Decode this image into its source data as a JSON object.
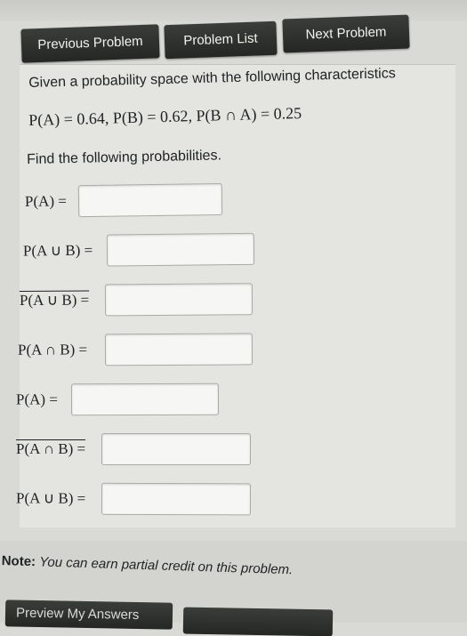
{
  "nav": {
    "previous_label": "Previous Problem",
    "list_label": "Problem List",
    "next_label": "Next Problem"
  },
  "problem": {
    "intro": "Given a probability space with the following characteristics",
    "given": "P(A) = 0.64, P(B) = 0.62, P(B ∩ A) = 0.25",
    "find": "Find the following probabilities."
  },
  "answers": [
    {
      "label_pre": "P(A) =",
      "value": ""
    },
    {
      "label_pre": "P(A ∪ B) =",
      "value": ""
    },
    {
      "label_pre": "P(A ∪ B) =",
      "value": ""
    },
    {
      "label_pre": "P(A ∩ B) =",
      "value": ""
    },
    {
      "label_pre": "P(A) =",
      "value": ""
    },
    {
      "label_pre": "P(A ∩ B) =",
      "value": ""
    },
    {
      "label_pre": "P(A ∪ B) =",
      "value": ""
    }
  ],
  "note": {
    "bold": "Note:",
    "text": "You can earn partial credit on this problem."
  },
  "footer": {
    "preview_label": "Preview My Answers",
    "submit_label": ""
  }
}
